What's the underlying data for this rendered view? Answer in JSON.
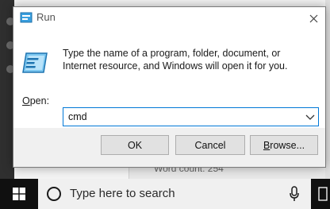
{
  "dialog": {
    "title": "Run",
    "description": "Type the name of a program, folder, document, or Internet resource, and Windows will open it for you.",
    "open_label_prefix": "O",
    "open_label_rest": "pen:",
    "input_value": "cmd",
    "buttons": {
      "ok": "OK",
      "cancel": "Cancel",
      "browse_prefix": "B",
      "browse_rest": "rowse..."
    }
  },
  "background": {
    "word_count": "Word count: 254"
  },
  "taskbar": {
    "search_placeholder": "Type here to search"
  },
  "icons": [
    "run-app-icon",
    "close-icon",
    "run-program-icon",
    "dropdown-arrow-icon",
    "windows-start-icon",
    "search-icon",
    "microphone-icon"
  ],
  "colors": {
    "accent": "#0078d7",
    "taskbar": "#101010",
    "dialog_bg": "#f0f0f0"
  }
}
